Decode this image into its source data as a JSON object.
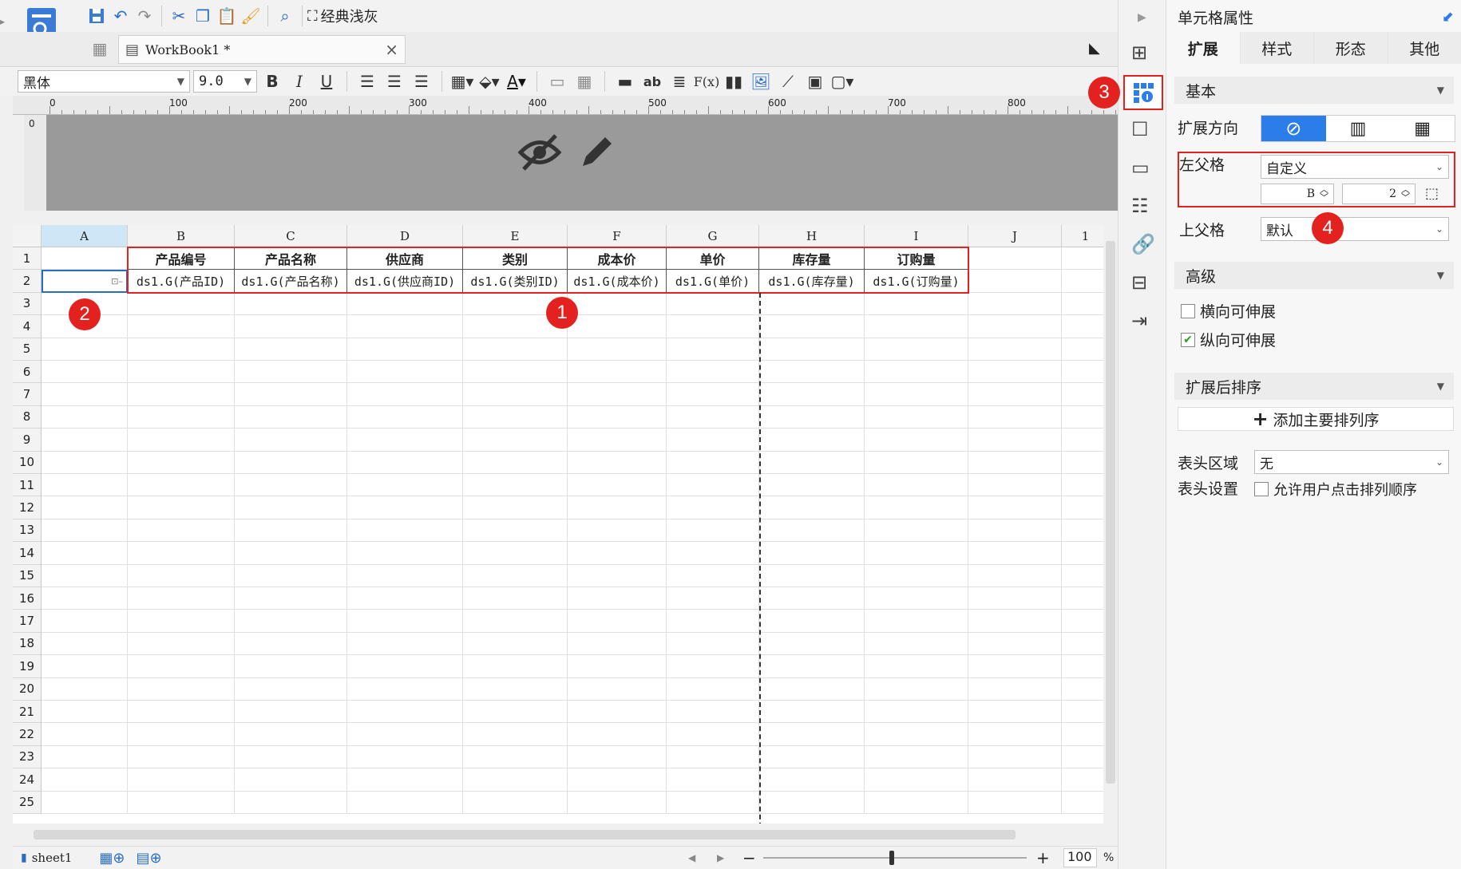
{
  "toolbar": {
    "theme_label": "经典浅灰"
  },
  "tab": {
    "name": "WorkBook1 *",
    "close": "×"
  },
  "format": {
    "font": "黑体",
    "size": "9.0",
    "bold": "B",
    "italic": "I",
    "underline": "U",
    "text_ab": "ab",
    "fx": "F(x)"
  },
  "ruler": {
    "ticks": [
      "0",
      "100",
      "200",
      "300",
      "400",
      "500",
      "600",
      "700",
      "800"
    ]
  },
  "grid": {
    "columns": [
      "A",
      "B",
      "C",
      "D",
      "E",
      "F",
      "G",
      "H",
      "I",
      "J",
      "1"
    ],
    "rows": [
      "1",
      "2",
      "3",
      "4",
      "5",
      "6",
      "7",
      "8",
      "9",
      "10",
      "11",
      "12",
      "13",
      "14",
      "15",
      "16",
      "17",
      "18",
      "19",
      "20",
      "21",
      "22",
      "23",
      "24",
      "25"
    ],
    "header_row": [
      "产品编号",
      "产品名称",
      "供应商",
      "类别",
      "成本价",
      "单价",
      "库存量",
      "订购量"
    ],
    "field_row": [
      "ds1.G(产品ID)",
      "ds1.G(产品名称)",
      "ds1.G(供应商ID)",
      "ds1.G(类别ID)",
      "ds1.G(成本价)",
      "ds1.G(单价)",
      "ds1.G(库存量)",
      "ds1.G(订购量)"
    ]
  },
  "badges": [
    "1",
    "2",
    "3",
    "4"
  ],
  "bottom": {
    "sheet": "sheet1",
    "zoom_minus": "−",
    "zoom_plus": "+",
    "zoom": "100",
    "percent": "%"
  },
  "panel": {
    "title": "单元格属性",
    "tabs": [
      "扩展",
      "样式",
      "形态",
      "其他"
    ],
    "basic": "基本",
    "expand_dir": "扩展方向",
    "left_parent": "左父格",
    "left_parent_value": "自定义",
    "left_col": "B",
    "left_row": "2",
    "top_parent": "上父格",
    "top_parent_value": "默认",
    "advanced": "高级",
    "h_stretch": "横向可伸展",
    "v_stretch": "纵向可伸展",
    "sort_after": "扩展后排序",
    "add_sort": "添加主要排列序",
    "header_area": "表头区域",
    "header_area_value": "无",
    "header_setting": "表头设置",
    "allow_sort": "允许用户点击排列顺序"
  },
  "colors": {
    "accent": "#2b7de9",
    "badge": "#e3221f",
    "highlight": "#e3221f"
  }
}
